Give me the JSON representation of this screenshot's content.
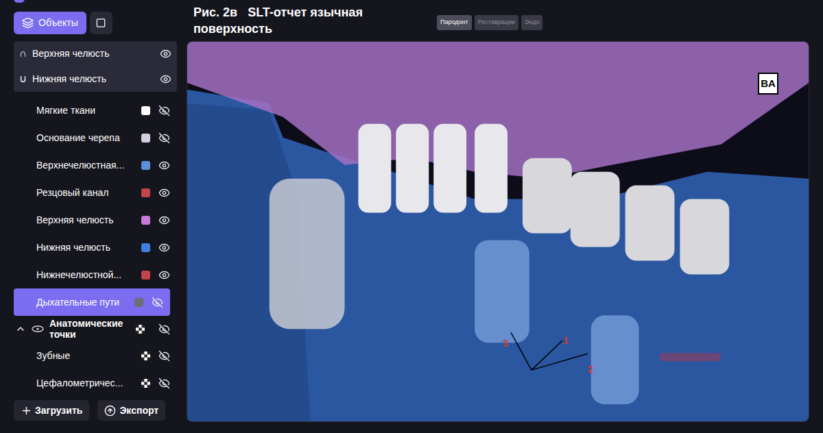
{
  "toolbar": {
    "objects_button": {
      "label": "Объекты",
      "selected": true
    },
    "view_button": {
      "selected": false
    }
  },
  "header": {
    "title": "Рис. 2в   SLT-отчет язычная поверхность"
  },
  "tabs": [
    {
      "label": "Пародонт",
      "selected": true
    },
    {
      "label": "Реставрации",
      "selected": false
    },
    {
      "label": "Эндо",
      "selected": false
    }
  ],
  "jaw_groups": [
    {
      "label": "Верхняя челюсть",
      "glyph": "∩",
      "visible": true
    },
    {
      "label": "Нижняя челюсть",
      "glyph": "∪",
      "visible": true
    }
  ],
  "layers": [
    {
      "label": "Мягкие ткани",
      "color": "#ffffff",
      "visible": false,
      "selected": false
    },
    {
      "label": "Основание черепа",
      "color": "#d4d0e4",
      "visible": false,
      "selected": false
    },
    {
      "label": "Верхнечелюстная...",
      "color": "#5b8fd9",
      "visible": true,
      "selected": false
    },
    {
      "label": "Резцовый канал",
      "color": "#c2454b",
      "visible": true,
      "selected": false
    },
    {
      "label": "Верхняя челюсть",
      "color": "#c77bd9",
      "visible": true,
      "selected": false
    },
    {
      "label": "Нижняя челюсть",
      "color": "#3f7fe2",
      "visible": true,
      "selected": false
    },
    {
      "label": "Нижнечелюстной...",
      "color": "#c2454b",
      "visible": true,
      "selected": false
    },
    {
      "label": "Дыхательные пути",
      "color": "#6e6e74",
      "visible": false,
      "selected": true
    }
  ],
  "anatomical_points": {
    "label": "Анатомические точки",
    "expanded": true,
    "visible": false,
    "items": [
      {
        "label": "Зубные",
        "visible": false
      },
      {
        "label": "Цефалометричес...",
        "visible": false
      }
    ]
  },
  "buttons": [
    {
      "label": "Загрузить"
    },
    {
      "label": "Экспорт"
    }
  ],
  "viewport": {
    "view_cube": "BA",
    "annotations": [
      {
        "label": "1"
      },
      {
        "label": "2"
      },
      {
        "label": "3"
      }
    ]
  }
}
